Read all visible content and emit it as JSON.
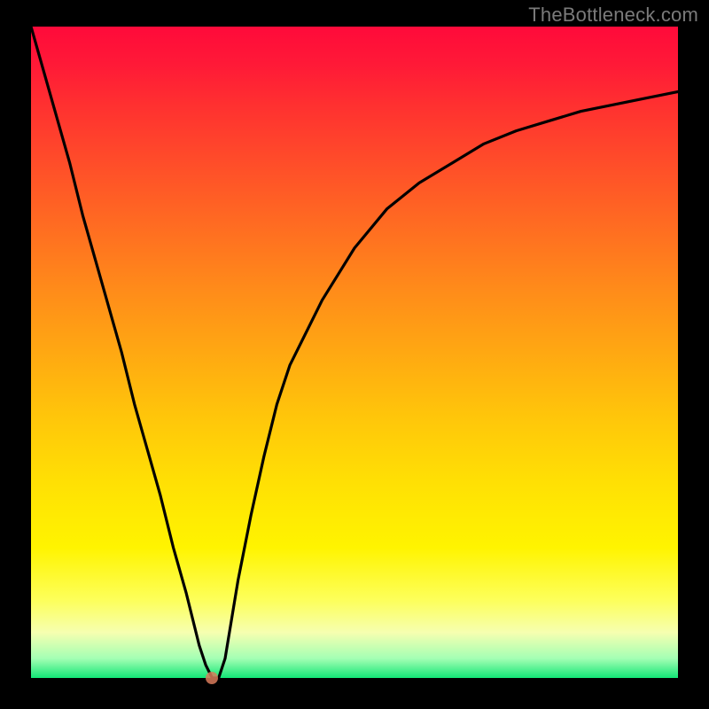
{
  "watermark": "TheBottleneck.com",
  "colors": {
    "frame": "#000000",
    "curve": "#000000",
    "dot": "#d87a5a"
  },
  "chart_data": {
    "type": "line",
    "title": "",
    "xlabel": "",
    "ylabel": "",
    "xlim": [
      0,
      100
    ],
    "ylim": [
      0,
      100
    ],
    "grid": false,
    "x": [
      0,
      2,
      4,
      6,
      8,
      10,
      12,
      14,
      16,
      18,
      20,
      22,
      24,
      26,
      27,
      28,
      29,
      30,
      31,
      32,
      34,
      36,
      38,
      40,
      45,
      50,
      55,
      60,
      65,
      70,
      75,
      80,
      85,
      90,
      95,
      100
    ],
    "values": [
      100,
      93,
      86,
      79,
      71,
      64,
      57,
      50,
      42,
      35,
      28,
      20,
      13,
      5,
      2,
      0,
      0,
      3,
      9,
      15,
      25,
      34,
      42,
      48,
      58,
      66,
      72,
      76,
      79,
      82,
      84,
      85.5,
      87,
      88,
      89,
      90
    ],
    "minimum_point": {
      "x": 28,
      "y": 0
    },
    "annotations": []
  }
}
